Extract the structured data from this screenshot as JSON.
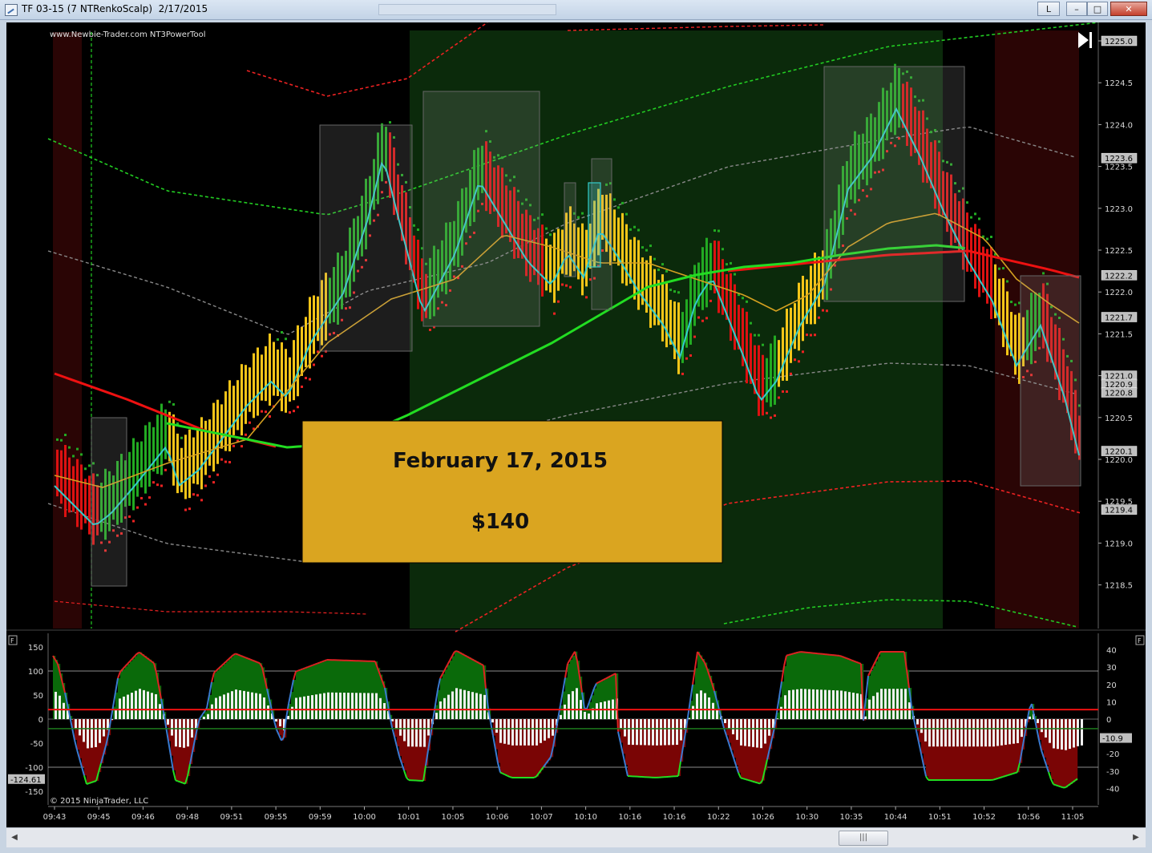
{
  "window": {
    "title": "TF 03-15 (7 NTRenkoScalp)  2/17/2015",
    "btn_l": "L",
    "btn_min": "–",
    "btn_max": "□",
    "btn_close": "✕"
  },
  "price_panel": {
    "watermark": "www.Newbie-Trader.com NT3PowerTool",
    "axis_ticks": [
      "1225.0",
      "1224.5",
      "1224.0",
      "1223.5",
      "1223.0",
      "1222.5",
      "1222.0",
      "1221.5",
      "1221.0",
      "1220.5",
      "1220.0",
      "1219.5",
      "1219.0",
      "1218.5"
    ],
    "price_tags": [
      {
        "value": "1225.0",
        "color": "#bfbfbf"
      },
      {
        "value": "1223.6",
        "color": "#bfbfbf"
      },
      {
        "value": "1222.2",
        "color": "#bfbfbf"
      },
      {
        "value": "1221.7",
        "color": "#bfbfbf"
      },
      {
        "value": "1221.0",
        "color": "#bfbfbf"
      },
      {
        "value": "1220.9",
        "color": "#bfbfbf"
      },
      {
        "value": "1220.8",
        "color": "#bfbfbf"
      },
      {
        "value": "1220.1",
        "color": "#bfbfbf"
      },
      {
        "value": "1219.4",
        "color": "#bfbfbf"
      }
    ],
    "banner_date": "February 17, 2015",
    "banner_amount": "$140",
    "banner_color": "#daa520"
  },
  "indicator_panel": {
    "left_ticks": [
      "150",
      "100",
      "50",
      "0",
      "-50",
      "-100",
      "-150"
    ],
    "right_ticks": [
      "40",
      "30",
      "20",
      "10",
      "0",
      "-10",
      "-20",
      "-30",
      "-40"
    ],
    "left_tag": "-124.61",
    "right_tag": "-10.9",
    "copyright": "© 2015 NinjaTrader, LLC",
    "panel_marker": "F"
  },
  "time_axis": {
    "labels": [
      "09:43",
      "09:45",
      "09:46",
      "09:48",
      "09:51",
      "09:55",
      "09:59",
      "10:00",
      "10:01",
      "10:05",
      "10:06",
      "10:07",
      "10:10",
      "10:16",
      "10:16",
      "10:22",
      "10:26",
      "10:30",
      "10:35",
      "10:44",
      "10:51",
      "10:52",
      "10:56",
      "11:05"
    ]
  },
  "colors": {
    "bull": "#22aa22",
    "bear": "#dd1111",
    "neutral": "#f5c518",
    "cyan_ma": "#33cccc",
    "green_zone": "#0b2a0b",
    "red_zone": "#2a0505"
  },
  "scrollbar": {
    "thumb_label": "|||",
    "left_arrow": "◀",
    "right_arrow": "▶"
  }
}
